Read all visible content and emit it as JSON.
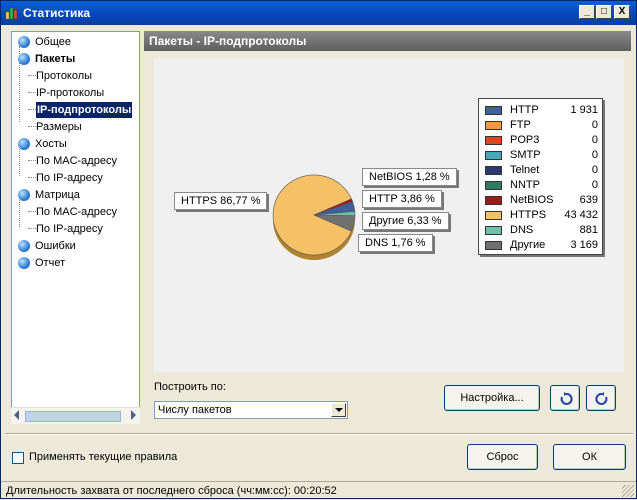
{
  "window": {
    "title": "Статистика",
    "minimize": "_",
    "maximize": "□",
    "close": "X"
  },
  "tree": {
    "cut_label": "Общее",
    "items": [
      {
        "label": "Общее",
        "type": "top",
        "bold": false
      },
      {
        "label": "Пакеты",
        "type": "top",
        "bold": true
      },
      {
        "label": "Протоколы",
        "type": "sub"
      },
      {
        "label": "IP-протоколы",
        "type": "sub"
      },
      {
        "label": "IP-подпротоколы",
        "type": "sub",
        "selected": true
      },
      {
        "label": "Размеры",
        "type": "sub"
      },
      {
        "label": "Хосты",
        "type": "top",
        "bold": false
      },
      {
        "label": "По MAC-адресу",
        "type": "sub"
      },
      {
        "label": "По IP-адресу",
        "type": "sub"
      },
      {
        "label": "Матрица",
        "type": "top",
        "bold": false
      },
      {
        "label": "По MAC-адресу",
        "type": "sub"
      },
      {
        "label": "По IP-адресу",
        "type": "sub"
      },
      {
        "label": "Ошибки",
        "type": "top",
        "bold": false
      },
      {
        "label": "Отчет",
        "type": "top",
        "bold": false
      }
    ]
  },
  "panel": {
    "title": "Пакеты - IP-подпротоколы"
  },
  "chart_data": {
    "type": "pie",
    "legend_placement": "right",
    "series": [
      {
        "name": "HTTP",
        "value": 1931,
        "color": "#3f5f9f",
        "display": "1 931"
      },
      {
        "name": "FTP",
        "value": 0,
        "color": "#f59a3c",
        "display": "0"
      },
      {
        "name": "POP3",
        "value": 0,
        "color": "#e8431c",
        "display": "0"
      },
      {
        "name": "SMTP",
        "value": 0,
        "color": "#4aa6b8",
        "display": "0"
      },
      {
        "name": "Telnet",
        "value": 0,
        "color": "#2b3b6e",
        "display": "0"
      },
      {
        "name": "NNTP",
        "value": 0,
        "color": "#2f7a63",
        "display": "0"
      },
      {
        "name": "NetBIOS",
        "value": 639,
        "color": "#a01919",
        "display": "639"
      },
      {
        "name": "HTTPS",
        "value": 43432,
        "color": "#f6c066",
        "display": "43 432"
      },
      {
        "name": "DNS",
        "value": 881,
        "color": "#6fc0a8",
        "display": "881"
      },
      {
        "name": "Другие",
        "value": 3169,
        "color": "#707070",
        "display": "3 169"
      }
    ],
    "callouts": {
      "https": "HTTPS 86,77 %",
      "netbios": "NetBIOS 1,28 %",
      "http": "HTTP 3,86 %",
      "other": "Другие 6,33 %",
      "dns": "DNS 1,76 %"
    }
  },
  "controls": {
    "build_by_label": "Построить по:",
    "build_by_value": "Числу пакетов",
    "settings_button": "Настройка...",
    "apply_rules_label": "Применять текущие правила",
    "reset_button": "Сброс",
    "ok_button": "ОК"
  },
  "status": {
    "text": "Длительность захвата от последнего сброса (чч:мм:сс): 00:20:52"
  }
}
